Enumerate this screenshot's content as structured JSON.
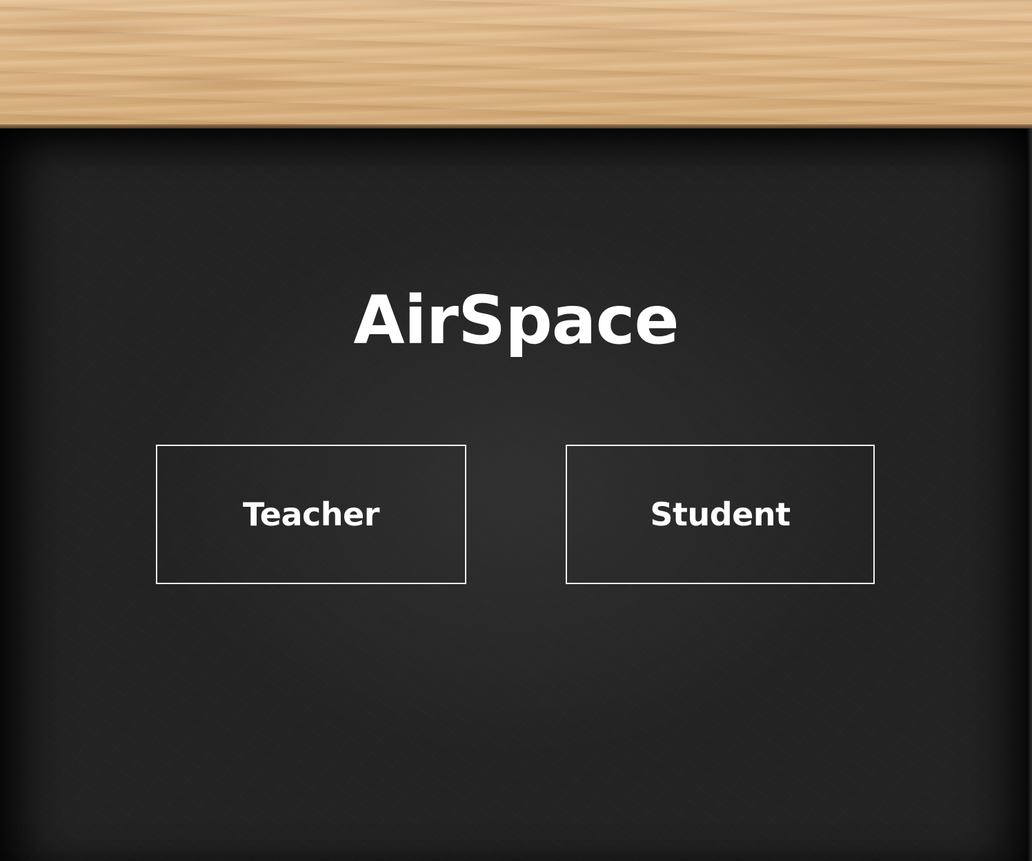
{
  "app": {
    "title": "AirSpace"
  },
  "roles": {
    "teacher_label": "Teacher",
    "student_label": "Student"
  }
}
